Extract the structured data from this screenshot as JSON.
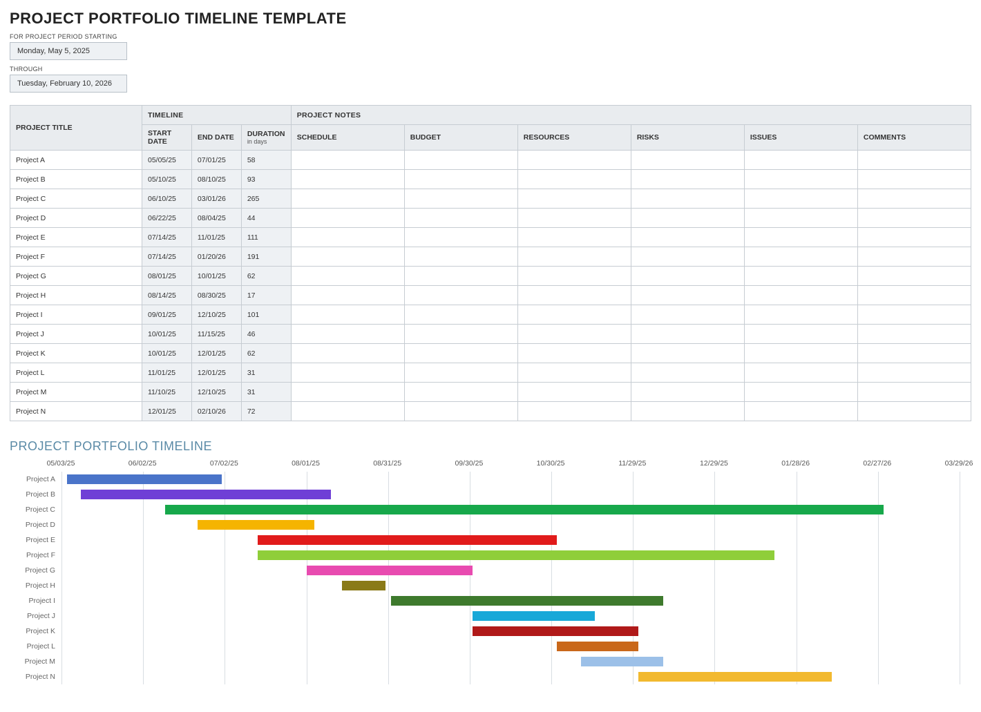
{
  "header": {
    "title": "PROJECT PORTFOLIO TIMELINE TEMPLATE",
    "period_start_label": "FOR PROJECT PERIOD STARTING",
    "period_start_value": "Monday, May 5, 2025",
    "through_label": "THROUGH",
    "period_end_value": "Tuesday, February 10, 2026"
  },
  "table": {
    "group_timeline": "TIMELINE",
    "group_notes": "PROJECT NOTES",
    "col_project_title": "PROJECT TITLE",
    "col_start": "START DATE",
    "col_end": "END DATE",
    "col_duration": "DURATION",
    "col_duration_sub": "in days",
    "col_schedule": "SCHEDULE",
    "col_budget": "BUDGET",
    "col_resources": "RESOURCES",
    "col_risks": "RISKS",
    "col_issues": "ISSUES",
    "col_comments": "COMMENTS",
    "rows": [
      {
        "title": "Project A",
        "start": "05/05/25",
        "end": "07/01/25",
        "duration": "58",
        "schedule": "",
        "budget": "",
        "resources": "",
        "risks": "",
        "issues": "",
        "comments": ""
      },
      {
        "title": "Project B",
        "start": "05/10/25",
        "end": "08/10/25",
        "duration": "93",
        "schedule": "",
        "budget": "",
        "resources": "",
        "risks": "",
        "issues": "",
        "comments": ""
      },
      {
        "title": "Project C",
        "start": "06/10/25",
        "end": "03/01/26",
        "duration": "265",
        "schedule": "",
        "budget": "",
        "resources": "",
        "risks": "",
        "issues": "",
        "comments": ""
      },
      {
        "title": "Project D",
        "start": "06/22/25",
        "end": "08/04/25",
        "duration": "44",
        "schedule": "",
        "budget": "",
        "resources": "",
        "risks": "",
        "issues": "",
        "comments": ""
      },
      {
        "title": "Project E",
        "start": "07/14/25",
        "end": "11/01/25",
        "duration": "111",
        "schedule": "",
        "budget": "",
        "resources": "",
        "risks": "",
        "issues": "",
        "comments": ""
      },
      {
        "title": "Project F",
        "start": "07/14/25",
        "end": "01/20/26",
        "duration": "191",
        "schedule": "",
        "budget": "",
        "resources": "",
        "risks": "",
        "issues": "",
        "comments": ""
      },
      {
        "title": "Project G",
        "start": "08/01/25",
        "end": "10/01/25",
        "duration": "62",
        "schedule": "",
        "budget": "",
        "resources": "",
        "risks": "",
        "issues": "",
        "comments": ""
      },
      {
        "title": "Project H",
        "start": "08/14/25",
        "end": "08/30/25",
        "duration": "17",
        "schedule": "",
        "budget": "",
        "resources": "",
        "risks": "",
        "issues": "",
        "comments": ""
      },
      {
        "title": "Project I",
        "start": "09/01/25",
        "end": "12/10/25",
        "duration": "101",
        "schedule": "",
        "budget": "",
        "resources": "",
        "risks": "",
        "issues": "",
        "comments": ""
      },
      {
        "title": "Project J",
        "start": "10/01/25",
        "end": "11/15/25",
        "duration": "46",
        "schedule": "",
        "budget": "",
        "resources": "",
        "risks": "",
        "issues": "",
        "comments": ""
      },
      {
        "title": "Project K",
        "start": "10/01/25",
        "end": "12/01/25",
        "duration": "62",
        "schedule": "",
        "budget": "",
        "resources": "",
        "risks": "",
        "issues": "",
        "comments": ""
      },
      {
        "title": "Project L",
        "start": "11/01/25",
        "end": "12/01/25",
        "duration": "31",
        "schedule": "",
        "budget": "",
        "resources": "",
        "risks": "",
        "issues": "",
        "comments": ""
      },
      {
        "title": "Project M",
        "start": "11/10/25",
        "end": "12/10/25",
        "duration": "31",
        "schedule": "",
        "budget": "",
        "resources": "",
        "risks": "",
        "issues": "",
        "comments": ""
      },
      {
        "title": "Project N",
        "start": "12/01/25",
        "end": "02/10/26",
        "duration": "72",
        "schedule": "",
        "budget": "",
        "resources": "",
        "risks": "",
        "issues": "",
        "comments": ""
      }
    ]
  },
  "chart_title": "PROJECT PORTFOLIO TIMELINE",
  "chart_data": {
    "type": "gantt",
    "x_axis_ticks": [
      "05/03/25",
      "06/02/25",
      "07/02/25",
      "08/01/25",
      "08/31/25",
      "09/30/25",
      "10/30/25",
      "11/29/25",
      "12/29/25",
      "01/28/26",
      "02/27/26",
      "03/29/26"
    ],
    "x_min": "05/03/25",
    "x_max": "03/29/26",
    "series": [
      {
        "name": "Project A",
        "start": "05/05/25",
        "end": "07/01/25",
        "color": "#4a74c9"
      },
      {
        "name": "Project B",
        "start": "05/10/25",
        "end": "08/10/25",
        "color": "#6f3fd6"
      },
      {
        "name": "Project C",
        "start": "06/10/25",
        "end": "03/01/26",
        "color": "#17a84b"
      },
      {
        "name": "Project D",
        "start": "06/22/25",
        "end": "08/04/25",
        "color": "#f5b400"
      },
      {
        "name": "Project E",
        "start": "07/14/25",
        "end": "11/01/25",
        "color": "#e11b1b"
      },
      {
        "name": "Project F",
        "start": "07/14/25",
        "end": "01/20/26",
        "color": "#8fce3a"
      },
      {
        "name": "Project G",
        "start": "08/01/25",
        "end": "10/01/25",
        "color": "#e84bb0"
      },
      {
        "name": "Project H",
        "start": "08/14/25",
        "end": "08/30/25",
        "color": "#8a7a18"
      },
      {
        "name": "Project I",
        "start": "09/01/25",
        "end": "12/10/25",
        "color": "#3e7a2d"
      },
      {
        "name": "Project J",
        "start": "10/01/25",
        "end": "11/15/25",
        "color": "#18a8d8"
      },
      {
        "name": "Project K",
        "start": "10/01/25",
        "end": "12/01/25",
        "color": "#b01919"
      },
      {
        "name": "Project L",
        "start": "11/01/25",
        "end": "12/01/25",
        "color": "#c9681a"
      },
      {
        "name": "Project M",
        "start": "11/10/25",
        "end": "12/10/25",
        "color": "#9cc0e8"
      },
      {
        "name": "Project N",
        "start": "12/01/25",
        "end": "02/10/26",
        "color": "#f2b92f"
      }
    ]
  }
}
